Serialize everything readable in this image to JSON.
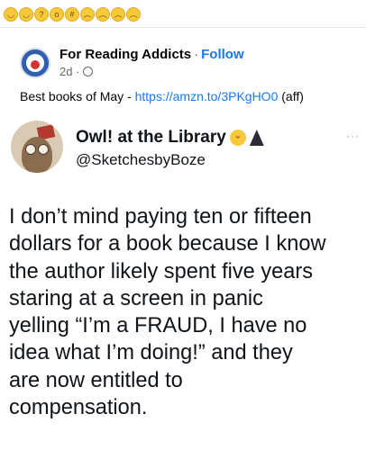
{
  "reactions": [
    {
      "icon": "grinning-sweat-emoji",
      "glyph": "◡"
    },
    {
      "icon": "smiling-blush-emoji",
      "glyph": "◡"
    },
    {
      "icon": "thinking-face-emoji",
      "glyph": "?"
    },
    {
      "icon": "flushed-face-emoji",
      "glyph": "o"
    },
    {
      "icon": "grimacing-face-emoji",
      "glyph": "#"
    },
    {
      "icon": "frowning-face-emoji",
      "glyph": "︵"
    },
    {
      "icon": "pleading-face-emoji",
      "glyph": "︵"
    },
    {
      "icon": "crying-face-emoji",
      "glyph": "︵"
    },
    {
      "icon": "sobbing-face-emoji",
      "glyph": "︵"
    }
  ],
  "facebook_post": {
    "author": "For Reading Addicts",
    "separator": "·",
    "follow_label": "Follow",
    "time": "2d ·",
    "text_prefix": "Best books of May - ",
    "link": "https://amzn.to/3PKgHO0",
    "text_suffix": " (aff)"
  },
  "tweet": {
    "display_name": "Owl! at the Library",
    "handle": "@SketchesbyBoze",
    "more": "···",
    "body_lines": [
      "I don’t mind paying ten or fifteen",
      "dollars for a book because I know",
      "the author likely spent five years",
      "staring at a screen in panic",
      "yelling “I’m a FRAUD, I have no",
      "idea what I’m doing!” and they",
      "are now entitled to",
      "compensation."
    ]
  }
}
